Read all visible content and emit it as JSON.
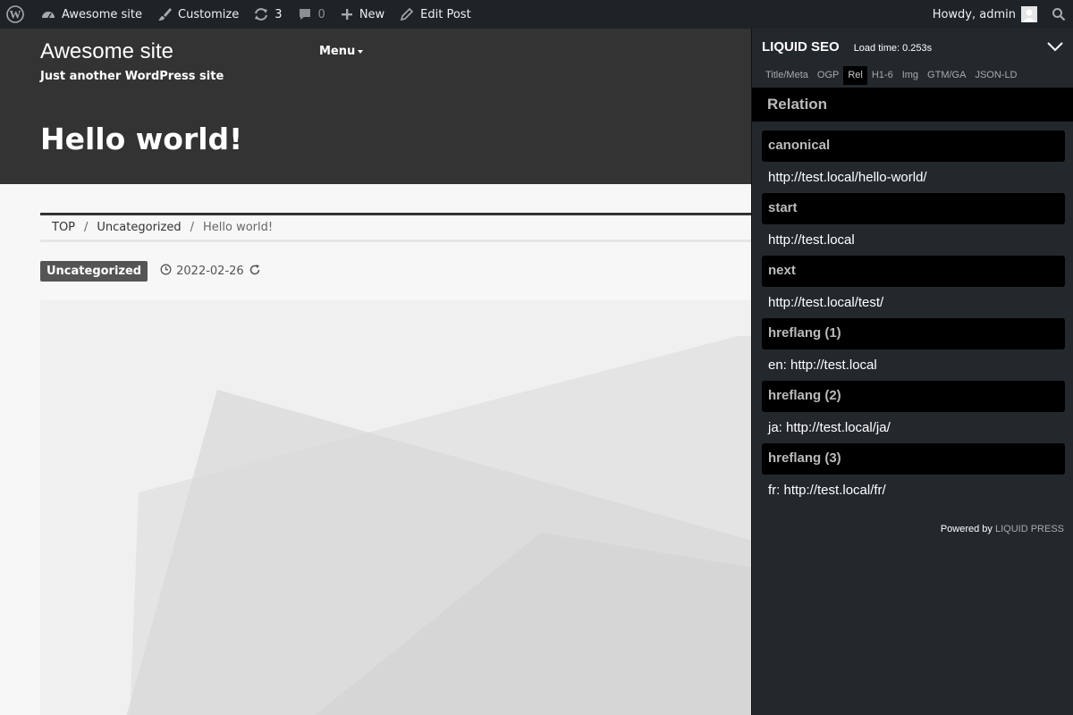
{
  "adminbar": {
    "site_name": "Awesome site",
    "customize": "Customize",
    "updates_count": "3",
    "comments_count": "0",
    "new_label": "New",
    "edit_post": "Edit Post",
    "howdy": "Howdy, admin"
  },
  "site": {
    "title": "Awesome site",
    "tagline": "Just another WordPress site",
    "menu_label": "Menu"
  },
  "post": {
    "title": "Hello world!",
    "category": "Uncategorized",
    "date": "2022-02-26"
  },
  "breadcrumb": {
    "items": [
      "TOP",
      "Uncategorized",
      "Hello world!"
    ],
    "separator": "/"
  },
  "seo_panel": {
    "brand": "LIQUID SEO",
    "load_time": "Load time: 0.253s",
    "tabs": [
      "Title/Meta",
      "OGP",
      "Rel",
      "H1-6",
      "Img",
      "GTM/GA",
      "JSON-LD"
    ],
    "active_tab": "Rel",
    "section_title": "Relation",
    "relations": [
      {
        "key": "canonical",
        "value": "http://test.local/hello-world/"
      },
      {
        "key": "start",
        "value": "http://test.local"
      },
      {
        "key": "next",
        "value": "http://test.local/test/"
      },
      {
        "key": "hreflang (1)",
        "value": "en: http://test.local"
      },
      {
        "key": "hreflang (2)",
        "value": "ja: http://test.local/ja/"
      },
      {
        "key": "hreflang (3)",
        "value": "fr: http://test.local/fr/"
      }
    ],
    "footer_prefix": "Powered by",
    "footer_link": "LIQUID PRESS"
  },
  "colors": {
    "adminbar_bg": "#1d2327",
    "header_bg": "#333333",
    "panel_bg": "#23282d",
    "panel_section_bg": "#000000",
    "category_badge_bg": "#555555"
  },
  "icons": {
    "wordpress": "wordpress-logo-icon",
    "dashboard": "dashboard-icon",
    "customize": "paintbrush-icon",
    "updates": "refresh-icon",
    "comments": "comment-bubble-icon",
    "new": "plus-icon",
    "edit": "pencil-icon",
    "search": "search-icon",
    "collapse": "chevron-down-icon",
    "clock": "clock-icon",
    "updated": "reload-icon"
  }
}
